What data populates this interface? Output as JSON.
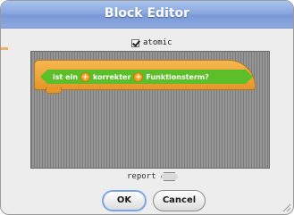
{
  "dialog": {
    "title": "Block Editor"
  },
  "atomic": {
    "label": "atomic",
    "checked": true
  },
  "block": {
    "text_1": "ist ein",
    "text_2": "korrekter",
    "text_3": "Funktionsterm?",
    "plus_symbol": "+",
    "hat_color": "#e6962a",
    "predicate_color": "#5cbf2a"
  },
  "report": {
    "label": "report"
  },
  "buttons": {
    "ok_label": "OK",
    "cancel_label": "Cancel"
  },
  "colors": {
    "titlebar": "#8aa8e0",
    "editor_bg": "#8d8d8d"
  },
  "icons": {
    "checkbox": "checkmark-icon",
    "resize": "resize-grip-icon"
  }
}
